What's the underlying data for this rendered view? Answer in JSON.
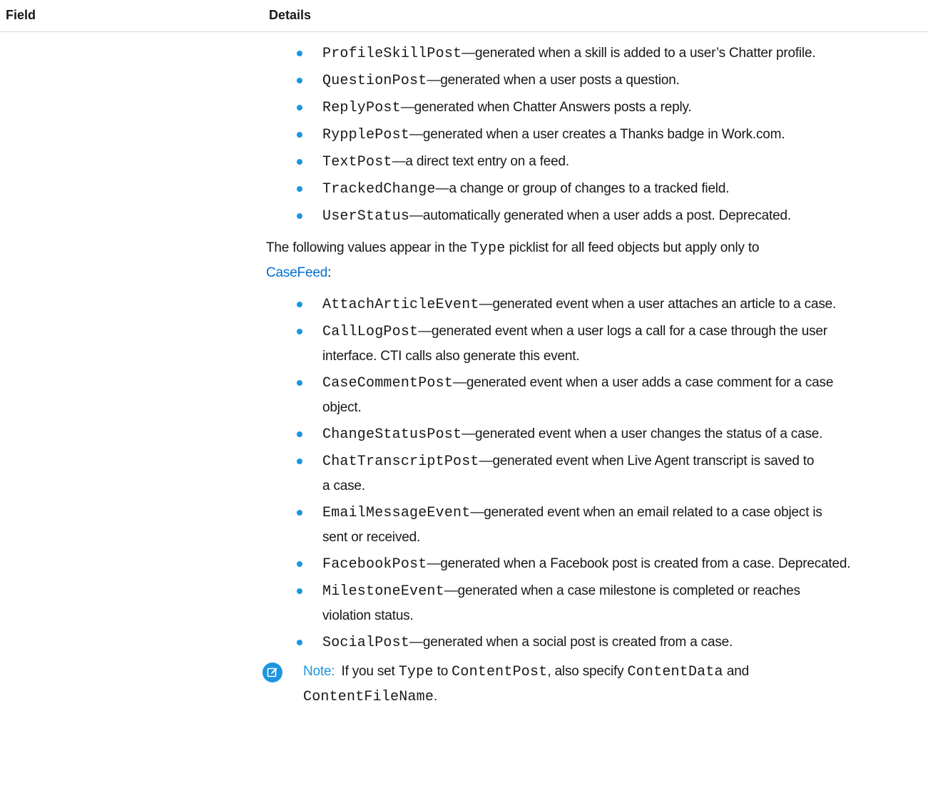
{
  "table": {
    "headers": {
      "field": "Field",
      "details": "Details"
    }
  },
  "list_one": [
    {
      "code": "ProfileSkillPost",
      "text": "—generated when a skill is added to a user’s Chatter profile."
    },
    {
      "code": "QuestionPost",
      "text": "—generated when a user posts a question."
    },
    {
      "code": "ReplyPost",
      "text": "—generated when Chatter Answers posts a reply."
    },
    {
      "code": "RypplePost",
      "text": "—generated when a user creates a Thanks badge in Work.com."
    },
    {
      "code": "TextPost",
      "text": "—a direct text entry on a feed."
    },
    {
      "code": "TrackedChange",
      "text": "—a change or group of changes to a tracked field."
    },
    {
      "code": "UserStatus",
      "text": "—automatically generated when a user adds a post. Deprecated."
    }
  ],
  "intro_paragraph": {
    "before": "The following values appear in the",
    "code": "Type",
    "after": "picklist for all feed objects but apply only to",
    "link": "CaseFeed",
    "end": ":"
  },
  "list_two": [
    {
      "code": "AttachArticleEvent",
      "text": "—generated event when a user attaches an article to a case."
    },
    {
      "code": "CallLogPost",
      "text": "—generated event when a user logs a call for a case through the user",
      "text2": "interface. CTI calls also generate this event."
    },
    {
      "code": "CaseCommentPost",
      "text": "—generated event when a user adds a case comment for a case",
      "text2": "object."
    },
    {
      "code": "ChangeStatusPost",
      "text": "—generated event when a user changes the status of a case."
    },
    {
      "code": "ChatTranscriptPost",
      "text": "—generated event when Live Agent transcript is saved to",
      "text2": "a case."
    },
    {
      "code": "EmailMessageEvent",
      "text": "—generated event when an email related to a case object is",
      "text2": "sent or received."
    },
    {
      "code": "FacebookPost",
      "text": "—generated when a Facebook post is created from a case. Deprecated."
    },
    {
      "code": "MilestoneEvent",
      "text": "—generated when a case milestone is completed or reaches",
      "text2": "violation status."
    },
    {
      "code": "SocialPost",
      "text": "—generated when a social post is created from a case."
    }
  ],
  "note": {
    "label": "Note:",
    "text1": "If you set",
    "code1": "Type",
    "text2": "to",
    "code2": "ContentPost",
    "text3": ", also specify",
    "code3": "ContentData",
    "text4": "and",
    "code4": "ContentFileName",
    "text5": "."
  },
  "colors": {
    "bullet": "#1d95e0",
    "link": "#0070d2",
    "note_accent": "#1d95e0"
  },
  "icons": {
    "bullet": "bullet-dot-icon",
    "note": "edit-note-icon"
  }
}
